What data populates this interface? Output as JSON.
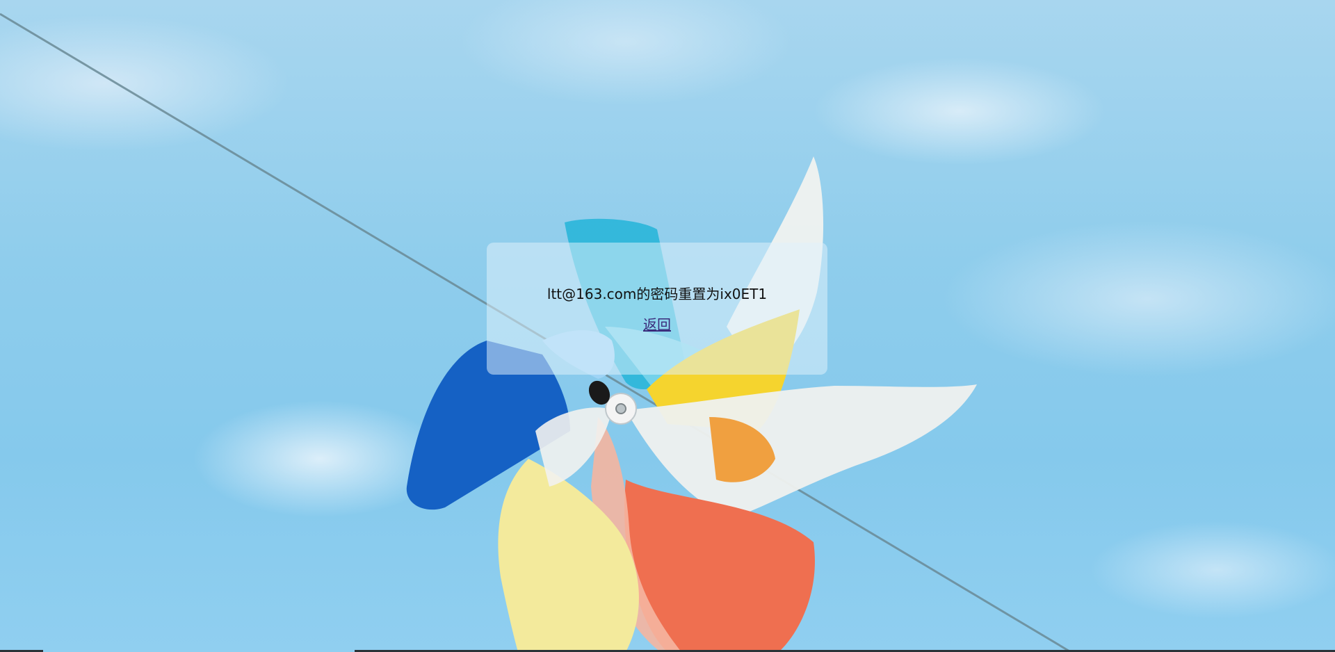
{
  "page": {
    "message": "ltt@163.com的密码重置为ix0ET1",
    "back_link": "返回"
  },
  "colors": {
    "sky": "#8fcdec",
    "card": "rgba(225,242,252,0.52)",
    "link": "#3a2a7a"
  },
  "background": {
    "subject": "pinwheel-on-wire"
  }
}
